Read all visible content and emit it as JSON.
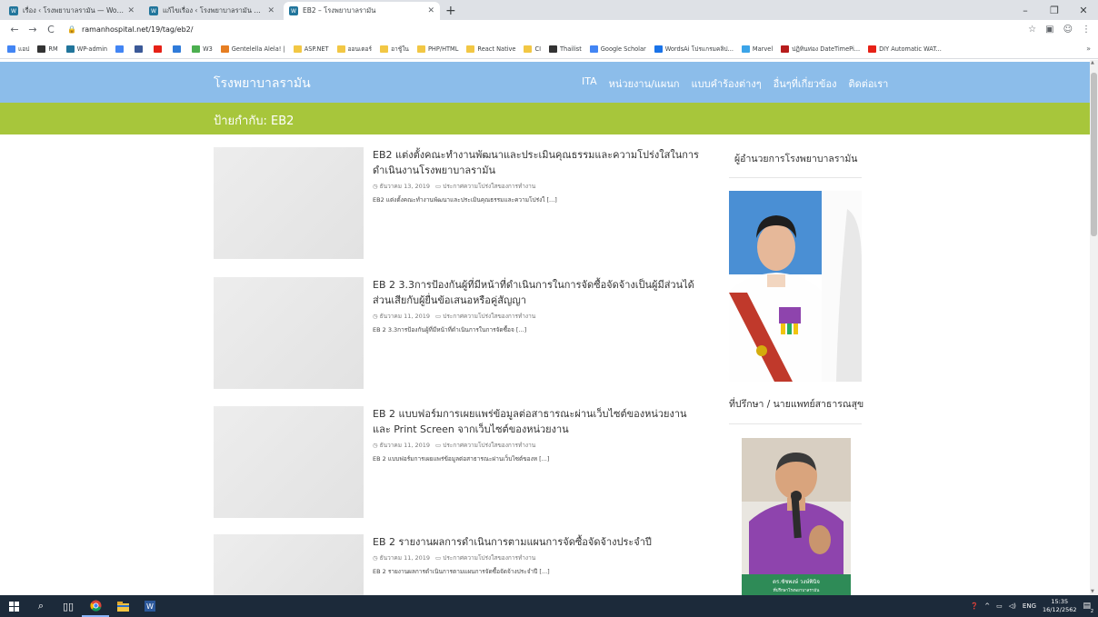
{
  "browser": {
    "tabs": [
      {
        "title": "เรื่อง ‹ โรงพยาบาลรามัน — WordPress",
        "active": false
      },
      {
        "title": "แก้ไขเรื่อง ‹ โรงพยาบาลรามัน — WordPress",
        "active": false
      },
      {
        "title": "EB2 – โรงพยาบาลรามัน",
        "active": true
      }
    ],
    "new_tab": "+",
    "window_controls": {
      "minimize": "–",
      "maximize": "❐",
      "close": "✕"
    },
    "nav": {
      "back": "←",
      "forward": "→",
      "reload": "C"
    },
    "url": "ramanhospital.net/19/tag/eb2/",
    "bookmarks": [
      {
        "label": "แอป",
        "color": "#4285f4"
      },
      {
        "label": "RM",
        "color": "#333333"
      },
      {
        "label": "WP-admin",
        "color": "#21759b"
      },
      {
        "label": "",
        "color": "#4285f4"
      },
      {
        "label": "",
        "color": "#3b5998"
      },
      {
        "label": "",
        "color": "#e62117"
      },
      {
        "label": "",
        "color": "#2f7bd9"
      },
      {
        "label": "W3",
        "color": "#4caf50"
      },
      {
        "label": "Gentelella Alela! |",
        "color": "#e67e22"
      },
      {
        "label": "ASP.NET",
        "color": "#f2c744"
      },
      {
        "label": "ออนเตอร์",
        "color": "#f2c744"
      },
      {
        "label": "อาชู้ใน",
        "color": "#f2c744"
      },
      {
        "label": "PHP/HTML",
        "color": "#f2c744"
      },
      {
        "label": "React Native",
        "color": "#f2c744"
      },
      {
        "label": "CI",
        "color": "#f2c744"
      },
      {
        "label": "Thailist",
        "color": "#333333"
      },
      {
        "label": "Google Scholar",
        "color": "#4285f4"
      },
      {
        "label": "WordsAi โปรแกรมคลิป...",
        "color": "#1a73e8"
      },
      {
        "label": "Marvel",
        "color": "#3ba4e8"
      },
      {
        "label": "ปฏิทินท่อง DateTimePi...",
        "color": "#b71c1c"
      },
      {
        "label": "DIY Automatic WAT...",
        "color": "#e62117"
      }
    ],
    "bookmarks_more": "»"
  },
  "site": {
    "title": "โรงพยาบาลรามัน",
    "nav": [
      "ITA",
      "หน่วยงาน/แผนก",
      "แบบคำร้องต่างๆ",
      "อื่นๆที่เกี่ยวข้อง",
      "ติดต่อเรา"
    ],
    "tag_heading": "ป้ายกำกับ: EB2",
    "posts": [
      {
        "title": "EB2 แต่งตั้งคณะทำงานพัฒนาและประเมินคุณธรรมและความโปร่งใสในการดำเนินงานโรงพยาบาลรามัน",
        "date": "ธันวาคม 13, 2019",
        "category": "ประกาศความโปร่งใสของการทำงาน",
        "excerpt": "EB2 แต่งตั้งคณะทำงานพัฒนาและประเมินคุณธรรมและความโปร่งใ [...]"
      },
      {
        "title": "EB 2 3.3การป้องกันผู้ที่มีหน้าที่ดำเนินการในการจัดซื้อจัดจ้างเป็นผู้มีส่วนได้ส่วนเสียกับผู้ยื่นข้อเสนอหรือคู่สัญญา",
        "date": "ธันวาคม 11, 2019",
        "category": "ประกาศความโปร่งใสของการทำงาน",
        "excerpt": "EB 2 3.3การป้องกันผู้ที่มีหน้าที่ดำเนินการในการจัดซื้อจ [...]"
      },
      {
        "title": "EB 2 แบบฟอร์มการเผยแพร่ข้อมูลต่อสาธารณะผ่านเว็บไซต์ของหน่วยงาน และ Print Screen จากเว็บไซต์ของหน่วยงาน",
        "date": "ธันวาคม 11, 2019",
        "category": "ประกาศความโปร่งใสของการทำงาน",
        "excerpt": "EB 2 แบบฟอร์มการเผยแพร่ข้อมูลต่อสาธารณะผ่านเว็บไซต์ของห [...]"
      },
      {
        "title": "EB 2 รายงานผลการดำเนินการตามแผนการจัดซื้อจัดจ้างประจำปี",
        "date": "ธันวาคม 11, 2019",
        "category": "ประกาศความโปร่งใสของการทำงาน",
        "excerpt": "EB 2 รายงานผลการดำเนินการตามแผนการจัดซื้อจัดจ้างประจำปี [...]"
      }
    ],
    "sidebar": {
      "widget1_title": "ผู้อำนวยการโรงพยาบาลรามัน",
      "widget2_title": "ที่ปรึกษา / นายแพทย์สาธารณสุข",
      "photo2_caption_line1": "ดร.ชัชพงษ์ วงษ์พินิจ",
      "photo2_caption_line2": "ที่ปรึกษาโรงพยาบาลรามัน"
    }
  },
  "taskbar": {
    "language": "ENG",
    "time": "15:35",
    "date": "16/12/2562",
    "notification_count": "2"
  }
}
